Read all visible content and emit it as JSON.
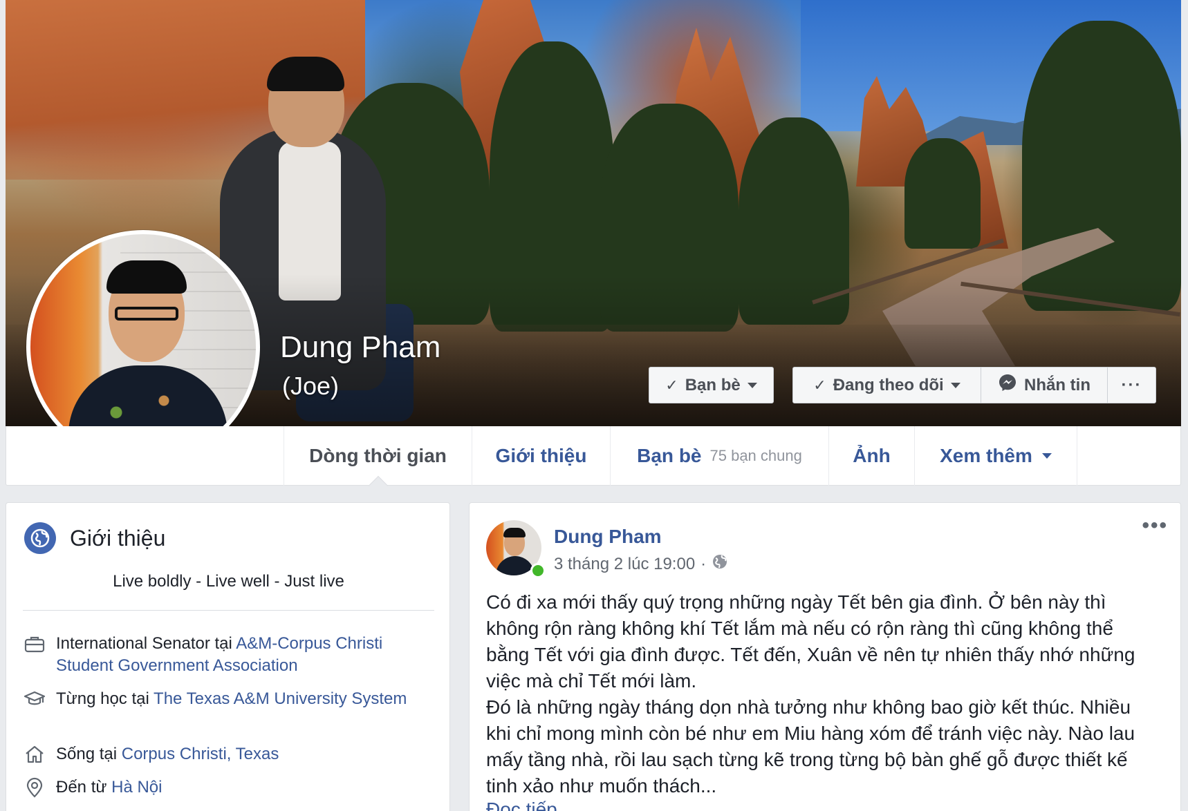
{
  "profile": {
    "name": "Dung Pham",
    "alternate_name": "(Joe)"
  },
  "actions": {
    "friends_label": "Bạn bè",
    "following_label": "Đang theo dõi",
    "message_label": "Nhắn tin",
    "more_label": "···"
  },
  "nav": {
    "timeline": "Dòng thời gian",
    "about": "Giới thiệu",
    "friends": "Bạn bè",
    "mutual_friends": "75 bạn chung",
    "photos": "Ảnh",
    "more": "Xem thêm"
  },
  "intro": {
    "title": "Giới thiệu",
    "bio": "Live boldly - Live well - Just live",
    "work": {
      "prefix": "International Senator tại ",
      "link": "A&M-Corpus Christi Student Government Association"
    },
    "education": {
      "prefix": "Từng học tại ",
      "link": "The Texas A&M University System"
    },
    "lives": {
      "prefix": "Sống tại ",
      "link": "Corpus Christi, Texas"
    },
    "from": {
      "prefix": "Đến từ ",
      "link": "Hà Nội"
    }
  },
  "post": {
    "author": "Dung Pham",
    "timestamp": "3 tháng 2 lúc 19:00",
    "separator": "·",
    "more_label": "•••",
    "paragraph1": "Có đi xa mới thấy quý trọng những ngày Tết bên gia đình. Ở bên này thì không rộn ràng không khí Tết lắm mà nếu có rộn ràng thì cũng không thể bằng Tết với gia đình được. Tết đến, Xuân về nên tự nhiên thấy nhớ những việc mà chỉ Tết mới làm.",
    "paragraph2": "Đó là những ngày tháng dọn nhà tưởng như không bao giờ kết thúc. Nhiều khi chỉ mong mình còn bé như em Miu hàng xóm để tránh việc này. Nào lau mấy tầng nhà, rồi lau sạch từng kẽ trong từng bộ bàn ghế gỗ được thiết kế tinh xảo như muốn thách...",
    "read_more": "Đọc tiếp"
  },
  "colors": {
    "link": "#385898",
    "brand": "#4267b2",
    "online": "#42b72a",
    "background": "#e9ebee"
  }
}
